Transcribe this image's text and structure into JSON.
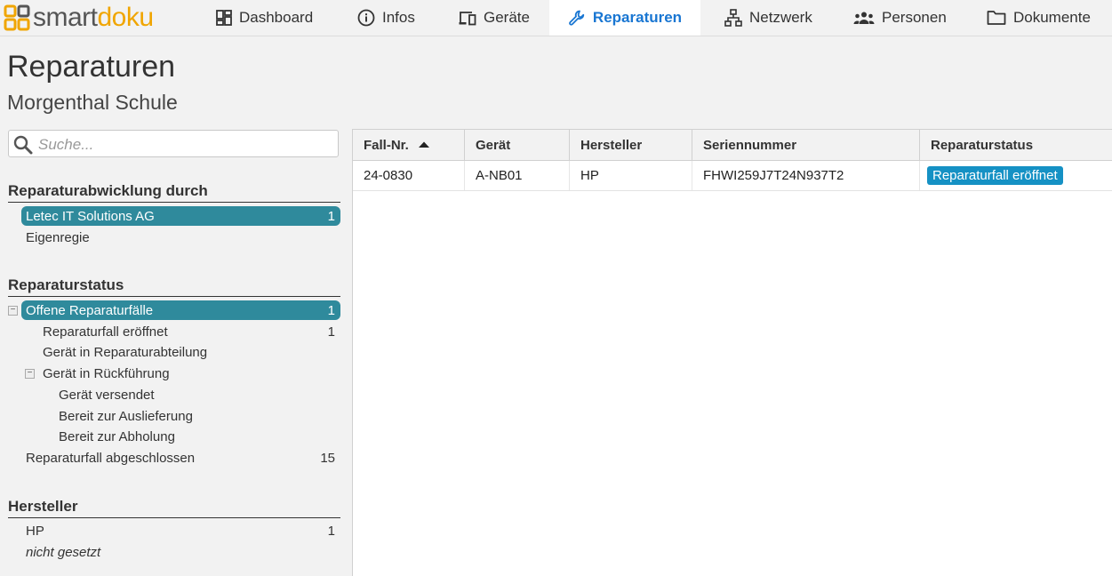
{
  "app": {
    "logo_part1": "smart",
    "logo_part2": "doku",
    "brand_color": "#f0a500"
  },
  "nav": [
    {
      "label": "Dashboard",
      "icon": "dashboard-icon"
    },
    {
      "label": "Infos",
      "icon": "info-icon"
    },
    {
      "label": "Geräte",
      "icon": "devices-icon"
    },
    {
      "label": "Reparaturen",
      "icon": "wrench-icon",
      "active": true
    },
    {
      "label": "Netzwerk",
      "icon": "network-icon"
    },
    {
      "label": "Personen",
      "icon": "people-icon"
    },
    {
      "label": "Dokumente",
      "icon": "folder-icon"
    }
  ],
  "page": {
    "title": "Reparaturen",
    "subtitle": "Morgenthal Schule"
  },
  "search": {
    "placeholder": "Suche..."
  },
  "filters": {
    "abwicklung": {
      "title": "Reparaturabwicklung durch",
      "items": [
        {
          "label": "Letec IT Solutions AG",
          "count": "1",
          "selected": true
        },
        {
          "label": "Eigenregie",
          "count": ""
        }
      ]
    },
    "status": {
      "title": "Reparaturstatus",
      "items": [
        {
          "label": "Offene Reparaturfälle",
          "count": "1",
          "selected": true
        },
        {
          "label": "Reparaturfall eröffnet",
          "count": "1"
        },
        {
          "label": "Gerät in Reparaturabteilung",
          "count": ""
        },
        {
          "label": "Gerät in Rückführung",
          "count": ""
        },
        {
          "label": "Gerät versendet",
          "count": ""
        },
        {
          "label": "Bereit zur Auslieferung",
          "count": ""
        },
        {
          "label": "Bereit zur Abholung",
          "count": ""
        },
        {
          "label": "Reparaturfall abgeschlossen",
          "count": "15"
        }
      ]
    },
    "hersteller": {
      "title": "Hersteller",
      "items": [
        {
          "label": "HP",
          "count": "1"
        },
        {
          "label": "nicht gesetzt",
          "count": ""
        }
      ]
    }
  },
  "table": {
    "columns": [
      "Fall-Nr.",
      "Gerät",
      "Hersteller",
      "Seriennummer",
      "Reparaturstatus"
    ],
    "sort_column": "Fall-Nr.",
    "sort_direction": "ascending",
    "rows": [
      {
        "fall_nr": "24-0830",
        "geraet": "A-NB01",
        "hersteller": "HP",
        "seriennummer": "FHWI259J7T24N937T2",
        "status": "Reparaturfall eröffnet"
      }
    ]
  },
  "colors": {
    "selected_bg": "#2f8a9c",
    "active_nav": "#1976d2",
    "status_badge": "#1591c4"
  }
}
